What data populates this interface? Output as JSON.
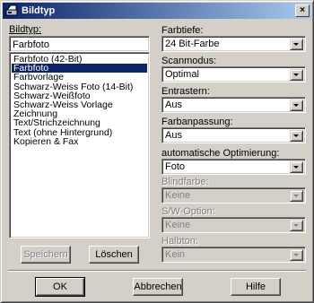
{
  "window": {
    "title": "Bildtyp",
    "close_glyph": "×"
  },
  "bildtyp": {
    "label": "Bildtyp:",
    "input_value": "Farbfoto",
    "items": [
      "Farbfoto (42-Bit)",
      "Farbfoto",
      "Farbvorlage",
      "Schwarz-Weiss Foto (14-Bit)",
      "Schwarz-Weißfoto",
      "Schwarz-Weiss Vorlage",
      "Zeichnung",
      "Text/Strichzeichnung",
      "Text (ohne Hintergrund)",
      "Kopieren & Fax"
    ],
    "selected_index": 1
  },
  "fields": {
    "farbtiefe": {
      "label": "Farbtiefe:",
      "value": "24 Bit-Farbe"
    },
    "scanmodus": {
      "label": "Scanmodus:",
      "value": "Optimal"
    },
    "entrastern": {
      "label": "Entrastern:",
      "value": "Aus"
    },
    "farbanpassung": {
      "label": "Farbanpassung:",
      "value": "Aus"
    },
    "optimierung": {
      "label": "automatische Optimierung:",
      "value": "Foto"
    },
    "blindfarbe": {
      "label": "Blindfarbe:",
      "value": "Keine"
    },
    "sw_option": {
      "label": "S/W-Option:",
      "value": "Keine"
    },
    "halbton": {
      "label": "Halbton:",
      "value": "Kein"
    }
  },
  "buttons": {
    "speichern": "Speichern",
    "loeschen": "Löschen",
    "ok": "OK",
    "abbrechen": "Abbrechen",
    "hilfe": "Hilfe"
  },
  "colors": {
    "titlebar_start": "#0a246a",
    "titlebar_end": "#a6caf0",
    "selection": "#0a246a",
    "face": "#d4d0c8"
  }
}
